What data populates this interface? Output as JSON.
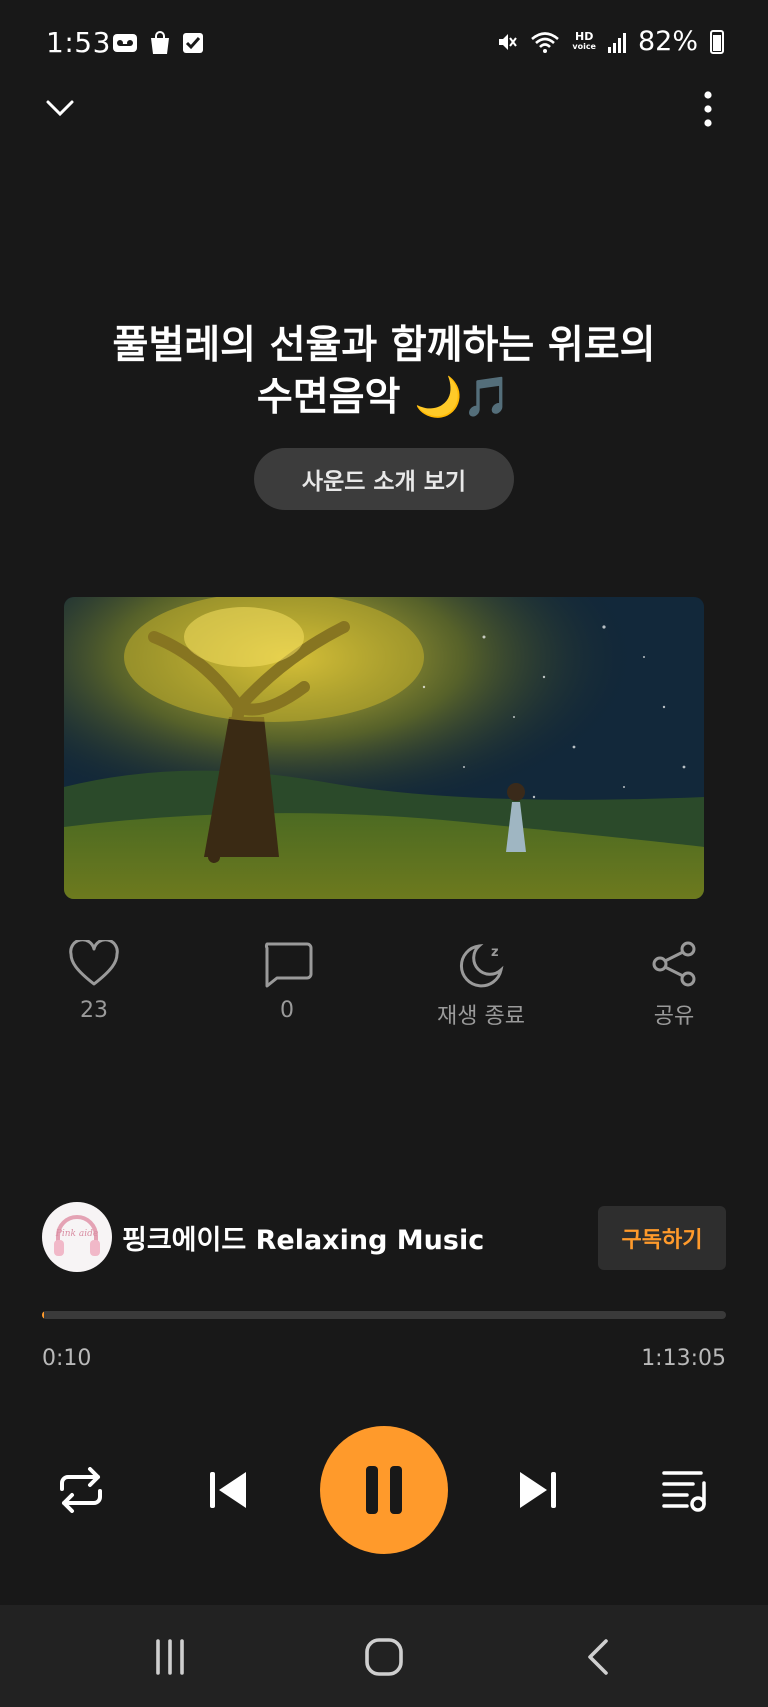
{
  "status_bar": {
    "time": "1:53",
    "battery": "82%",
    "left_icons": [
      "voicemail-icon",
      "shopping-bag-icon",
      "checkbox-icon"
    ],
    "right_icons": [
      "mute-icon",
      "wifi-icon",
      "hd-voice-icon",
      "signal-icon",
      "battery-icon"
    ],
    "hd_label": "HD",
    "voice_label": "voice"
  },
  "header": {
    "collapse_icon": "chevron-down-icon",
    "menu_icon": "more-vertical-icon"
  },
  "track": {
    "title_line1": "풀벌레의 선율과 함께하는 위로의",
    "title_line2": "수면음악 🌙🎵",
    "intro_button": "사운드 소개 보기"
  },
  "actions": {
    "like_count": "23",
    "comment_count": "0",
    "sleep_timer_label": "재생 종료",
    "share_label": "공유"
  },
  "channel": {
    "name": "핑크에이드 Relaxing Music",
    "avatar_text": "Pink aide",
    "subscribe_label": "구독하기"
  },
  "player": {
    "current_time": "0:10",
    "total_time": "1:13:05",
    "progress_fraction": 0.002
  },
  "colors": {
    "accent": "#ff9a2b",
    "background": "#181818"
  }
}
